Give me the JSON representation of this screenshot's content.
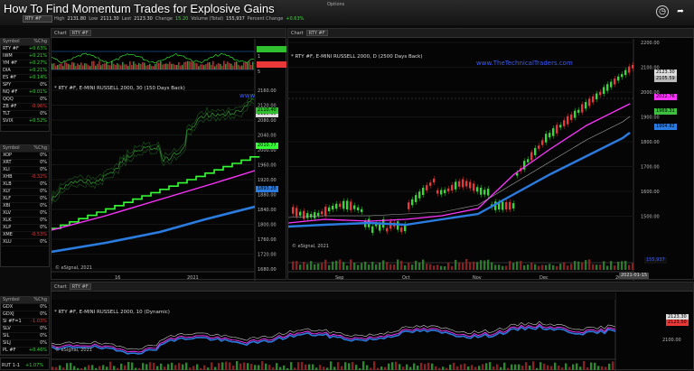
{
  "window": {
    "title": "How To Find Momentum Trades for Explosive Gains",
    "options_label": "Options",
    "header_symbol": "RTY #F"
  },
  "quote_bar": [
    {
      "k": "High",
      "v": "2131.80"
    },
    {
      "k": "Low",
      "v": "2111.30"
    },
    {
      "k": "Last",
      "v": "2123.30"
    },
    {
      "k": "Change",
      "v": "15.20"
    },
    {
      "k": "Volume (Total)",
      "v": "155,937"
    },
    {
      "k": "Percent Change",
      "v": "+0.63%"
    }
  ],
  "watchlist1": {
    "headers": [
      "Symbol",
      "%Chg"
    ],
    "rows": [
      [
        "RTY #F",
        "+0.63%",
        "pos"
      ],
      [
        "IWM",
        "+0.21%",
        "pos"
      ],
      [
        "YM #F",
        "+0.27%",
        "pos"
      ],
      [
        "DIA",
        "+0.21%",
        "pos"
      ],
      [
        "ES #F",
        "+0.14%",
        "pos"
      ],
      [
        "SPY",
        "0%",
        "neu"
      ],
      [
        "NQ #F",
        "+0.01%",
        "pos"
      ],
      [
        "QQQ",
        "0%",
        "neu"
      ],
      [
        "ZB #F",
        "-0.96%",
        "neg"
      ],
      [
        "TLT",
        "0%",
        "neu"
      ],
      [
        "SVIX",
        "+0.52%",
        "pos"
      ]
    ]
  },
  "watchlist2": {
    "headers": [
      "Symbol",
      "%Chg"
    ],
    "rows": [
      [
        "XOP",
        "0%",
        "neu"
      ],
      [
        "XRT",
        "0%",
        "neu"
      ],
      [
        "XLI",
        "0%",
        "neu"
      ],
      [
        "XHB",
        "-0.32%",
        "neg"
      ],
      [
        "XLB",
        "0%",
        "neu"
      ],
      [
        "XLY",
        "0%",
        "neu"
      ],
      [
        "XLF",
        "0%",
        "neu"
      ],
      [
        "XBI",
        "0%",
        "neu"
      ],
      [
        "XLV",
        "0%",
        "neu"
      ],
      [
        "XLK",
        "0%",
        "neu"
      ],
      [
        "XLP",
        "0%",
        "neu"
      ],
      [
        "XME",
        "-0.53%",
        "neg"
      ],
      [
        "XLU",
        "0%",
        "neu"
      ]
    ]
  },
  "watchlist3": {
    "headers": [
      "Symbol",
      "%Chg"
    ],
    "rows": [
      [
        "GDX",
        "0%",
        "neu"
      ],
      [
        "GDXJ",
        "0%",
        "neu"
      ],
      [
        "SI #F=1",
        "-1.03%",
        "neg"
      ],
      [
        "SLV",
        "0%",
        "neu"
      ],
      [
        "SIL",
        "0%",
        "neu"
      ],
      [
        "SILJ",
        "0%",
        "neu"
      ],
      [
        "PL #F",
        "+0.46%",
        "pos"
      ]
    ]
  },
  "chart_small": {
    "header_symbol": "RTY #F",
    "label": "* RTY #F, E-MINI RUSSELL 2000, 30 (150 Days Back)",
    "site": "www",
    "oscillator_ticks": [
      "1",
      "5"
    ],
    "y_ticks": [
      "2160.00",
      "2120.00",
      "2080.00",
      "2040.00",
      "2000.00",
      "1960.00",
      "1920.00",
      "1880.00",
      "1840.00",
      "1800.00",
      "1760.00",
      "1720.00",
      "1680.00"
    ],
    "x_ticks": [
      "16",
      "2021"
    ],
    "tags": [
      {
        "t": "2123.30",
        "c": "#dddddd"
      },
      {
        "t": "2110.40",
        "c": "#2fbf2f"
      },
      {
        "t": "2010.77",
        "c": "#33ff33"
      },
      {
        "t": "1893.28",
        "c": "#2a7ce0"
      }
    ],
    "watermark": "© eSignal, 2021"
  },
  "chart_main": {
    "header_symbol": "RTY #F",
    "label": "* RTY #F, E-MINI RUSSELL 2000, D (2500 Days Back)",
    "site": "www.TheTechnicalTraders.com",
    "y_ticks": [
      "2200.00",
      "2100.00",
      "2000.00",
      "1900.00",
      "1800.00",
      "1700.00",
      "1600.00",
      "1500.00"
    ],
    "x_ticks": [
      "Sep",
      "Oct",
      "Nov",
      "Dec",
      "2021"
    ],
    "date_label": "2021-01-15",
    "tags": [
      {
        "t": "2123.30",
        "c": "#dddddd"
      },
      {
        "t": "2105.59",
        "c": "#bbbbbb"
      },
      {
        "t": "2022.76",
        "c": "#ff33ff"
      },
      {
        "t": "1969.31",
        "c": "#3fbf3f"
      },
      {
        "t": "1904.82",
        "c": "#2a7ce0"
      }
    ],
    "volume_tag": "155,937",
    "watermark": "© eSignal, 2021",
    "zoom": "0.5"
  },
  "chart_bottom": {
    "header_symbol": "RTY #F",
    "label": "* RTY #F, E-MINI RUSSELL 2000, 10 (Dynamic)",
    "y_tick": "2100.00",
    "tags": [
      {
        "t": "2123.30",
        "c": "#dddddd"
      },
      {
        "t": "2123.50",
        "c": "#e83838"
      }
    ],
    "bottom_symbol": "RUT 1-1",
    "bottom_change": "+1.07%",
    "watermark": "© eSignal, 2021"
  },
  "colors": {
    "up": "#36d836",
    "down": "#e83838",
    "avg_blue": "#2a7ce0",
    "avg_magenta": "#ff33ff",
    "avg_green": "#33ff33"
  }
}
